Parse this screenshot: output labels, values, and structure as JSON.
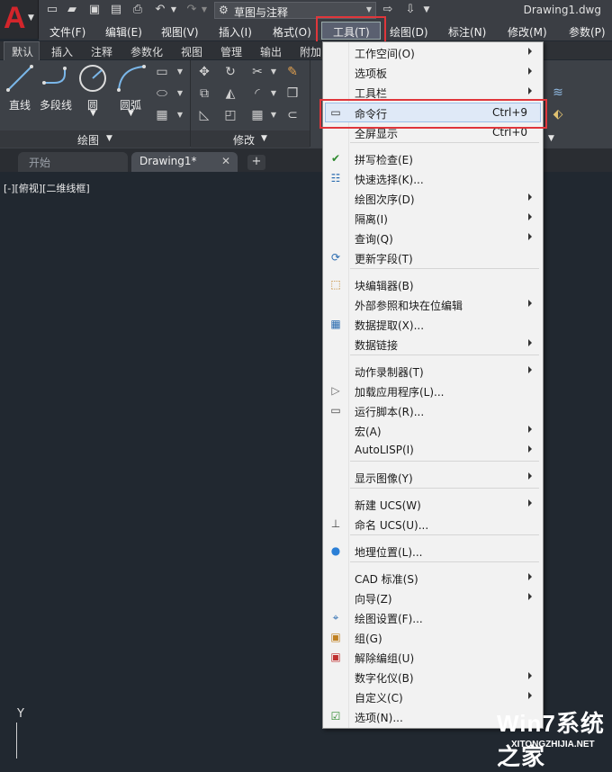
{
  "app": {
    "document_title": "Drawing1.dwg",
    "workspace": "草图与注释"
  },
  "menubar": [
    "文件(F)",
    "编辑(E)",
    "视图(V)",
    "插入(I)",
    "格式(O)",
    "工具(T)",
    "绘图(D)",
    "标注(N)",
    "修改(M)",
    "参数(P)"
  ],
  "ribbon_tabs": [
    "默认",
    "插入",
    "注释",
    "参数化",
    "视图",
    "管理",
    "输出",
    "附加"
  ],
  "ribbon": {
    "draw_tools": [
      "直线",
      "多段线",
      "圆",
      "圆弧"
    ],
    "group_draw": "绘图",
    "group_modify": "修改"
  },
  "file_tabs": {
    "start": "开始",
    "drawing": "Drawing1*",
    "plus": "+"
  },
  "viewport": {
    "label": "[-][俯视][二维线框]",
    "ucs_y": "Y"
  },
  "tools_menu": {
    "items": [
      {
        "label": "工作空间(O)",
        "submenu": true
      },
      {
        "label": "选项板",
        "submenu": true
      },
      {
        "label": "工具栏",
        "submenu": true
      },
      {
        "label": "命令行",
        "shortcut": "Ctrl+9"
      },
      {
        "label": "全屏显示",
        "shortcut": "Ctrl+0"
      },
      {
        "label": "拼写检查(E)"
      },
      {
        "label": "快速选择(K)..."
      },
      {
        "label": "绘图次序(D)",
        "submenu": true
      },
      {
        "label": "隔离(I)",
        "submenu": true
      },
      {
        "label": "查询(Q)",
        "submenu": true
      },
      {
        "label": "更新字段(T)"
      },
      {
        "label": "块编辑器(B)"
      },
      {
        "label": "外部参照和块在位编辑",
        "submenu": true
      },
      {
        "label": "数据提取(X)..."
      },
      {
        "label": "数据链接",
        "submenu": true
      },
      {
        "label": "动作录制器(T)",
        "submenu": true
      },
      {
        "label": "加载应用程序(L)..."
      },
      {
        "label": "运行脚本(R)..."
      },
      {
        "label": "宏(A)",
        "submenu": true
      },
      {
        "label": "AutoLISP(I)",
        "submenu": true
      },
      {
        "label": "显示图像(Y)",
        "submenu": true
      },
      {
        "label": "新建 UCS(W)",
        "submenu": true
      },
      {
        "label": "命名 UCS(U)..."
      },
      {
        "label": "地理位置(L)..."
      },
      {
        "label": "CAD 标准(S)",
        "submenu": true
      },
      {
        "label": "向导(Z)",
        "submenu": true
      },
      {
        "label": "绘图设置(F)..."
      },
      {
        "label": "组(G)"
      },
      {
        "label": "解除编组(U)"
      },
      {
        "label": "数字化仪(B)",
        "submenu": true
      },
      {
        "label": "自定义(C)",
        "submenu": true
      },
      {
        "label": "选项(N)..."
      }
    ]
  },
  "watermark": {
    "line1": "Win7系统之家",
    "line2": "XITONGZHIJIA.NET"
  },
  "colors": {
    "highlight_box": "#e0363b",
    "menu_bg": "#f2f2f2",
    "canvas": "#212830"
  }
}
